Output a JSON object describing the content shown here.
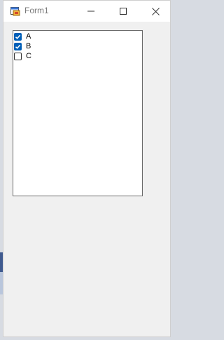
{
  "window": {
    "title": "Form1"
  },
  "titlebar": {
    "icons": [
      "app-icon",
      "minimize-icon",
      "maximize-icon",
      "close-icon"
    ]
  },
  "checklist": {
    "items": [
      {
        "label": "A",
        "checked": true
      },
      {
        "label": "B",
        "checked": true
      },
      {
        "label": "C",
        "checked": false
      }
    ]
  },
  "colors": {
    "checkbox_checked": "#005fb8",
    "window_background": "#f0f0f0"
  }
}
